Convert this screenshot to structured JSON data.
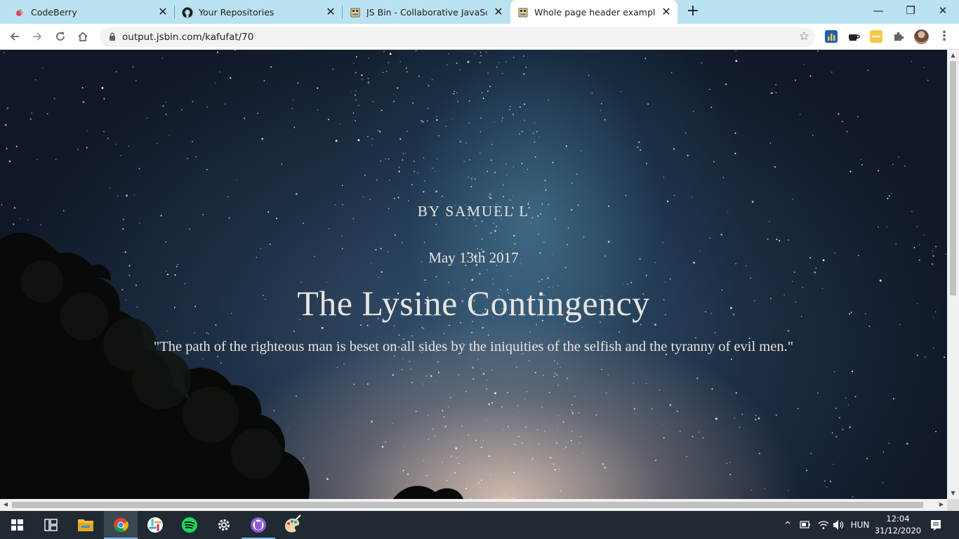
{
  "browser": {
    "tabs": [
      {
        "title": "CodeBerry",
        "active": false
      },
      {
        "title": "Your Repositories",
        "active": false
      },
      {
        "title": "JS Bin - Collaborative JavaScript D",
        "active": false
      },
      {
        "title": "Whole page header example",
        "active": true
      }
    ],
    "new_tab_symbol": "+",
    "window_controls": {
      "minimize": "—",
      "maximize": "❐",
      "close": "✕"
    },
    "url": "output.jsbin.com/kafufat/70",
    "accent": "#bbe2f0"
  },
  "page": {
    "author": "BY SAMUEL L",
    "date": "May 13th 2017",
    "title": "The Lysine Contingency",
    "quote": "\"The path of the righteous man is beset on all sides by the iniquities of the selfish and the tyranny of evil men.\""
  },
  "taskbar": {
    "apps": [
      "start-icon",
      "task-view-icon",
      "file-explorer-icon",
      "chrome-icon",
      "slack-icon",
      "spotify-icon",
      "settings-icon",
      "github-desktop-icon",
      "paint-icon"
    ],
    "language": "HUN",
    "time": "12:04",
    "date": "31/12/2020"
  }
}
